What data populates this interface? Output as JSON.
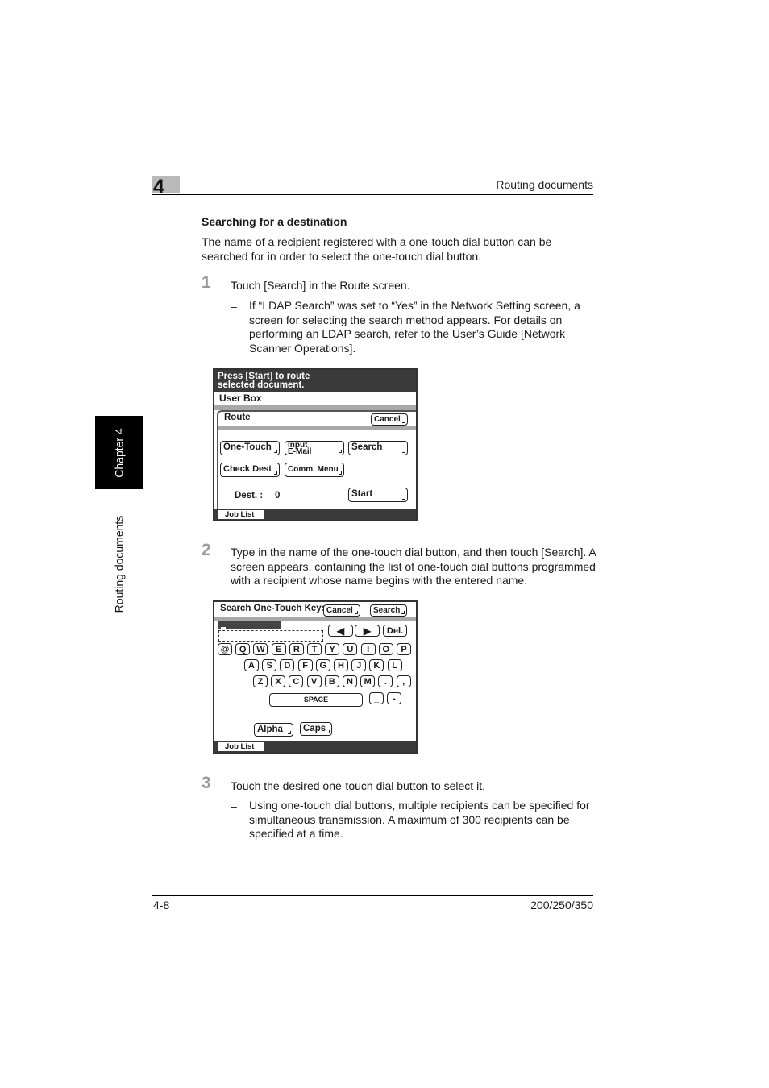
{
  "header": {
    "chapter_number": "4",
    "running_title": "Routing documents"
  },
  "side_tab": {
    "chapter_label": "Chapter 4",
    "section_label": "Routing documents"
  },
  "section": {
    "title": "Searching for a destination",
    "intro": "The name of a recipient registered with a one-touch dial button can be searched for in order to select the one-touch dial button."
  },
  "steps": [
    {
      "number": "1",
      "text": "Touch [Search] in the Route screen.",
      "bullet_dash": "–",
      "bullet": "If “LDAP Search” was set to “Yes” in the Network Setting screen, a screen for selecting the search method appears. For details on performing an LDAP search, refer to the User’s Guide [Network Scanner Operations]."
    },
    {
      "number": "2",
      "text": "Type in the name of the one-touch dial button, and then touch [Search]. A screen appears, containing the list of one-touch dial buttons programmed with a recipient whose name begins with the entered name."
    },
    {
      "number": "3",
      "text": "Touch the desired one-touch dial button to select it.",
      "bullet_dash": "–",
      "bullet": "Using one-touch dial buttons, multiple recipients can be specified for simultaneous transmission. A maximum of 300 recipients can be specified at a time."
    }
  ],
  "screen1": {
    "message_line1": "Press [Start] to route",
    "message_line2": "selected document.",
    "user_box": "User Box",
    "route_label": "Route",
    "cancel": "Cancel",
    "one_touch": "One-Touch",
    "input_email_line1": "Input",
    "input_email_line2": "E-Mail",
    "search": "Search",
    "check_dest": "Check Dest",
    "comm_menu": "Comm. Menu",
    "dest_label": "Dest.  :",
    "dest_value": "0",
    "start": "Start",
    "job_list": "Job List"
  },
  "screen2": {
    "title": "Search One-Touch Keys",
    "cancel": "Cancel",
    "search": "Search",
    "input_value": "",
    "left_arrow": "🡄",
    "right_arrow": "🡆",
    "delete": "Del.",
    "row1": [
      "@",
      "Q",
      "W",
      "E",
      "R",
      "T",
      "Y",
      "U",
      "I",
      "O",
      "P"
    ],
    "row2": [
      "A",
      "S",
      "D",
      "F",
      "G",
      "H",
      "J",
      "K",
      "L"
    ],
    "row3": [
      "Z",
      "X",
      "C",
      "V",
      "B",
      "N",
      "M",
      ".",
      ","
    ],
    "space": "SPACE",
    "underscore": "_",
    "hyphen": "-",
    "alpha": "Alpha",
    "caps": "Caps",
    "job_list": "Job List"
  },
  "footer": {
    "page_number": "4-8",
    "model": "200/250/350"
  }
}
